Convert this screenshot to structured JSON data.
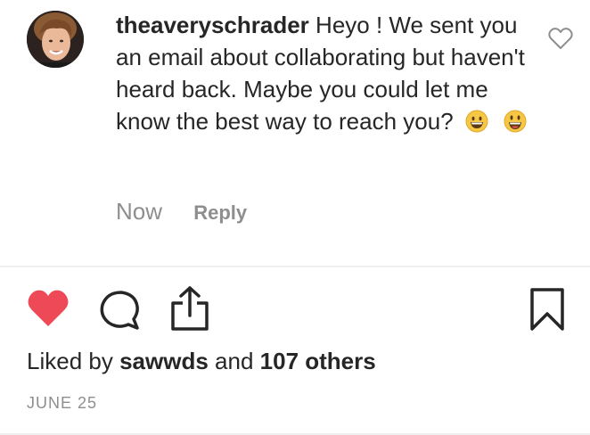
{
  "comment": {
    "username": "theaveryschrader",
    "text": "Heyo ! We sent you an email about collaborating but haven't heard back. Maybe you could let me know the best way to reach you?",
    "emojis": [
      "grinning-face-emoji",
      "smiley-face-emoji"
    ],
    "time": "Now",
    "reply_label": "Reply"
  },
  "actions": {
    "like_icon": "heart-filled-icon",
    "comment_icon": "comment-bubble-icon",
    "share_icon": "share-upload-icon",
    "save_icon": "bookmark-icon",
    "like_color": "#ed4956"
  },
  "likes": {
    "prefix": "Liked by",
    "user": "sawwds",
    "and": "and",
    "others": "107 others"
  },
  "date": "JUNE 25"
}
